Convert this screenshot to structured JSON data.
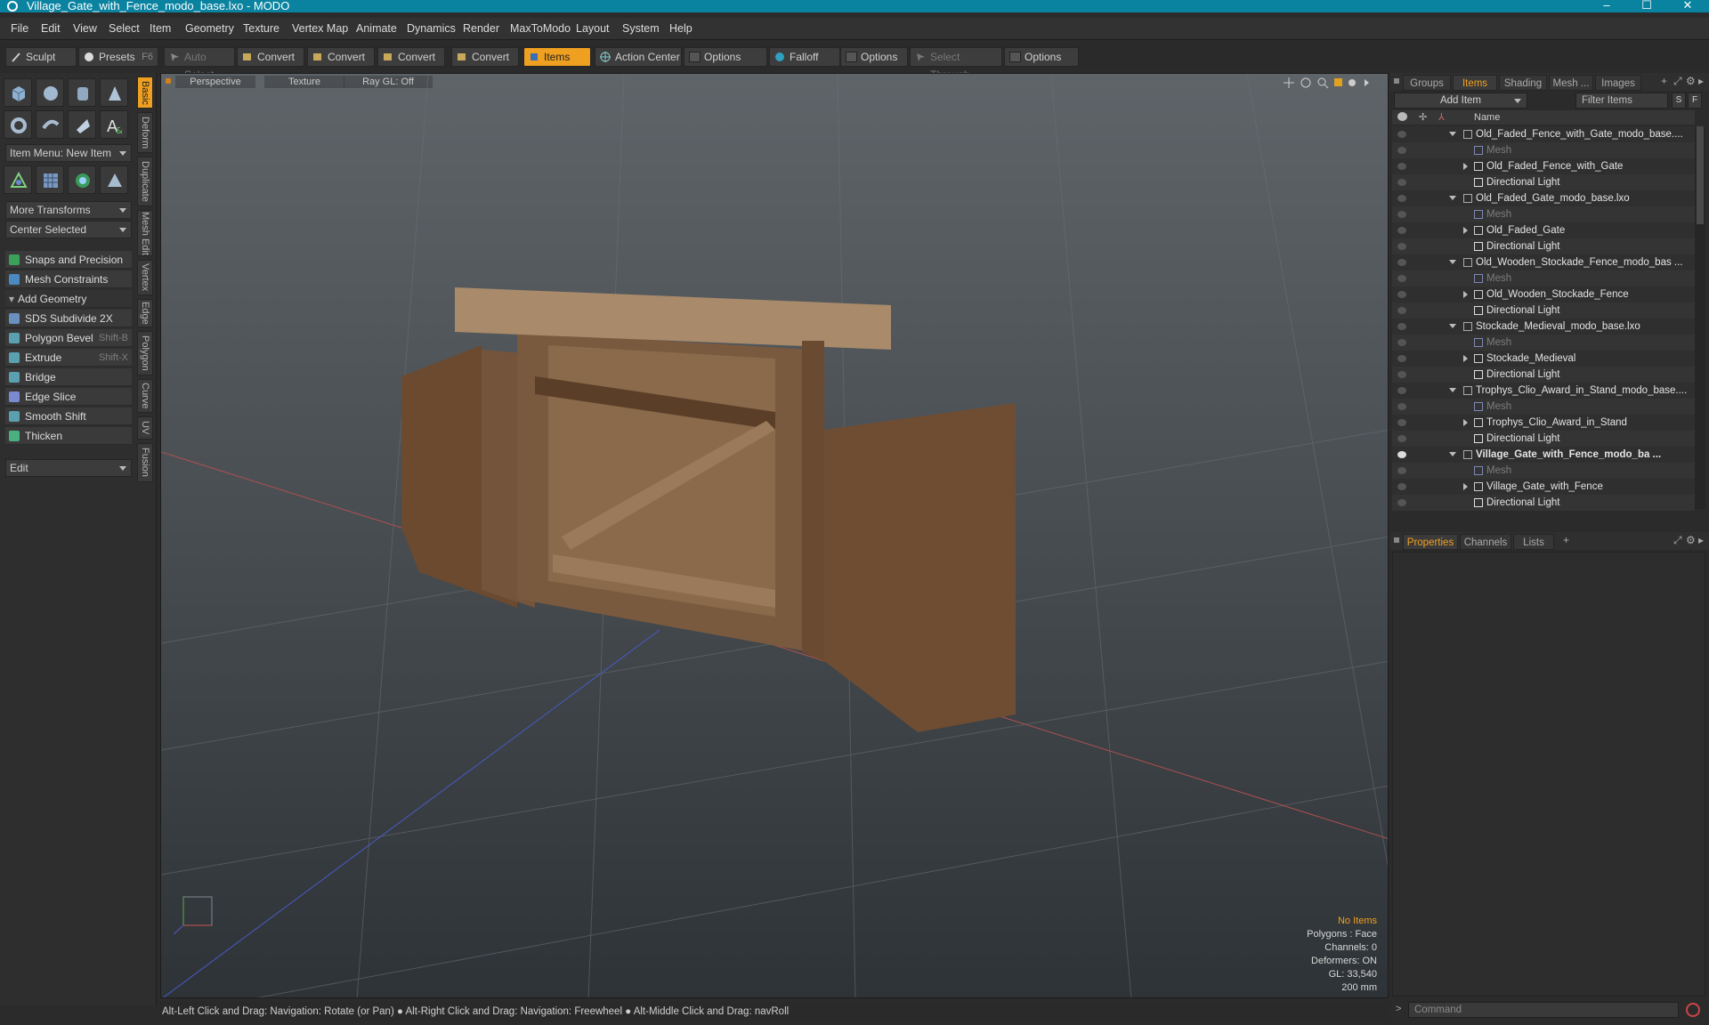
{
  "window": {
    "title": "Village_Gate_with_Fence_modo_base.lxo - MODO",
    "min": "–",
    "max": "☐",
    "close": "✕"
  },
  "menu": [
    "File",
    "Edit",
    "View",
    "Select",
    "Item",
    "Geometry",
    "Texture",
    "Vertex Map",
    "Animate",
    "Dynamics",
    "Render",
    "MaxToModo",
    "Layout",
    "System",
    "Help"
  ],
  "toolbar": {
    "sculpt": "Sculpt",
    "presets": "Presets",
    "presets_key": "F6",
    "auto_select": "Auto Select",
    "convert1": "Convert",
    "convert2": "Convert",
    "convert3": "Convert",
    "convert4": "Convert",
    "items": "Items",
    "action_center": "Action Center",
    "options1": "Options",
    "falloff": "Falloff",
    "options2": "Options",
    "select_through": "Select Through",
    "options3": "Options"
  },
  "left": {
    "item_menu": "Item Menu: New Item",
    "more_transforms": "More Transforms",
    "center_selected": "Center Selected",
    "snaps": "Snaps and Precision",
    "mesh_constraints": "Mesh Constraints",
    "add_geometry": "Add Geometry",
    "tools": [
      {
        "label": "SDS Subdivide 2X",
        "key": ""
      },
      {
        "label": "Polygon Bevel",
        "key": "Shift-B"
      },
      {
        "label": "Extrude",
        "key": "Shift-X"
      },
      {
        "label": "Bridge",
        "key": ""
      },
      {
        "label": "Edge Slice",
        "key": ""
      },
      {
        "label": "Smooth Shift",
        "key": ""
      },
      {
        "label": "Thicken",
        "key": ""
      }
    ],
    "edit": "Edit"
  },
  "vtabs": [
    "Basic",
    "Deform",
    "Duplicate",
    "Mesh Edit",
    "Vertex",
    "Edge",
    "Polygon",
    "Curve",
    "UV",
    "Fusion"
  ],
  "viewport": {
    "view": "Perspective",
    "shading": "Texture",
    "raygl": "Ray GL: Off",
    "info": {
      "no_items": "No Items",
      "polygons": "Polygons : Face",
      "channels": "Channels: 0",
      "deformers": "Deformers: ON",
      "gl": "GL: 33,540",
      "scale": "200 mm"
    }
  },
  "status": "Alt-Left Click and Drag: Navigation: Rotate (or Pan) ● Alt-Right Click and Drag: Navigation: Freewheel ● Alt-Middle Click and Drag: navRoll",
  "right": {
    "tabs": [
      "Groups",
      "Items",
      "Shading",
      "Mesh ...",
      "Images"
    ],
    "add_item": "Add Item",
    "filter": "Filter Items",
    "s": "S",
    "f": "F",
    "name_col": "Name",
    "tree": [
      {
        "level": 0,
        "label": "Old_Faded_Fence_with_Gate_modo_base....",
        "type": "scene",
        "open": true
      },
      {
        "level": 1,
        "label": "Mesh",
        "type": "mesh"
      },
      {
        "level": 1,
        "label": "Old_Faded_Fence_with_Gate",
        "type": "group",
        "collapsed": true
      },
      {
        "level": 1,
        "label": "Directional Light",
        "type": "light"
      },
      {
        "level": 0,
        "label": "Old_Faded_Gate_modo_base.lxo",
        "type": "scene",
        "open": true
      },
      {
        "level": 1,
        "label": "Mesh",
        "type": "mesh"
      },
      {
        "level": 1,
        "label": "Old_Faded_Gate",
        "type": "group",
        "collapsed": true
      },
      {
        "level": 1,
        "label": "Directional Light",
        "type": "light"
      },
      {
        "level": 0,
        "label": "Old_Wooden_Stockade_Fence_modo_bas ...",
        "type": "scene",
        "open": true
      },
      {
        "level": 1,
        "label": "Mesh",
        "type": "mesh"
      },
      {
        "level": 1,
        "label": "Old_Wooden_Stockade_Fence",
        "type": "group",
        "collapsed": true
      },
      {
        "level": 1,
        "label": "Directional Light",
        "type": "light"
      },
      {
        "level": 0,
        "label": "Stockade_Medieval_modo_base.lxo",
        "type": "scene",
        "open": true
      },
      {
        "level": 1,
        "label": "Mesh",
        "type": "mesh"
      },
      {
        "level": 1,
        "label": "Stockade_Medieval",
        "type": "group",
        "collapsed": true
      },
      {
        "level": 1,
        "label": "Directional Light",
        "type": "light"
      },
      {
        "level": 0,
        "label": "Trophys_Clio_Award_in_Stand_modo_base....",
        "type": "scene",
        "open": true
      },
      {
        "level": 1,
        "label": "Mesh",
        "type": "mesh"
      },
      {
        "level": 1,
        "label": "Trophys_Clio_Award_in_Stand",
        "type": "group",
        "collapsed": true
      },
      {
        "level": 1,
        "label": "Directional Light",
        "type": "light"
      },
      {
        "level": 0,
        "label": "Village_Gate_with_Fence_modo_ba ...",
        "type": "scene",
        "open": true,
        "bold": true
      },
      {
        "level": 1,
        "label": "Mesh",
        "type": "mesh"
      },
      {
        "level": 1,
        "label": "Village_Gate_with_Fence",
        "type": "group",
        "collapsed": true
      },
      {
        "level": 1,
        "label": "Directional Light",
        "type": "light"
      }
    ],
    "prop_tabs": [
      "Properties",
      "Channels",
      "Lists"
    ],
    "command": "Command"
  },
  "colors": {
    "accent": "#f0a020",
    "titlebar": "#0a83a0"
  }
}
